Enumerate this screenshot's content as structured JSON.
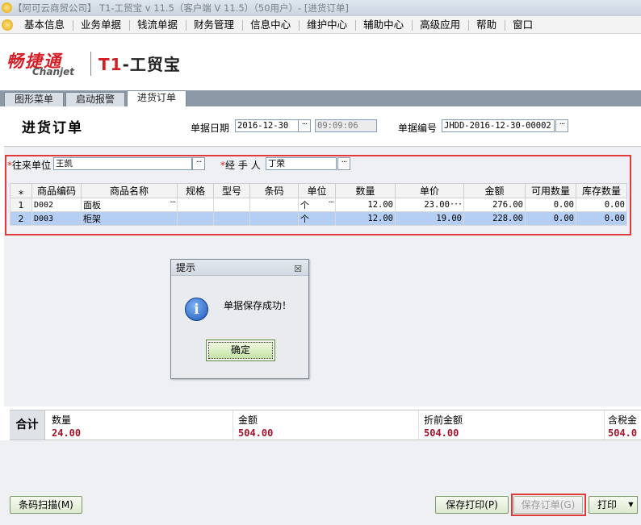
{
  "window": {
    "title": "【阿可云商贸公司】 T1-工贸宝 v 11.5（客户端 V 11.5）（50用户）- [进货订单]"
  },
  "menu": [
    "基本信息",
    "业务单据",
    "钱流单据",
    "财务管理",
    "信息中心",
    "维护中心",
    "辅助中心",
    "高级应用",
    "帮助",
    "窗口"
  ],
  "logo": {
    "brand_cn": "畅捷通",
    "brand_en": "Chanjet",
    "product_prefix": "T1",
    "product_name": "-工贸宝"
  },
  "tabs": [
    {
      "label": "图形菜单"
    },
    {
      "label": "启动报警"
    },
    {
      "label": "进货订单",
      "active": true
    }
  ],
  "form": {
    "title": "进货订单",
    "date_label": "单据日期",
    "date_value": "2016-12-30",
    "time_value": "09:09:06",
    "number_label": "单据编号",
    "number_value": "JHDD-2016-12-30-00002",
    "partner_label": "往来单位",
    "partner_value": "王凯",
    "handler_label": "经 手 人",
    "handler_value": "丁荣",
    "required_mark": "*",
    "dots": "···"
  },
  "table": {
    "corner": "⁎",
    "columns": [
      "商品编码",
      "商品名称",
      "规格",
      "型号",
      "条码",
      "单位",
      "数量",
      "单价",
      "金额",
      "可用数量",
      "库存数量"
    ],
    "rows": [
      {
        "idx": "1",
        "code": "D002",
        "name": "面板",
        "spec": "",
        "model": "",
        "barcode": "",
        "unit": "个",
        "qty": "12.00",
        "price": "23.00",
        "amount": "276.00",
        "avail": "0.00",
        "stock": "0.00"
      },
      {
        "idx": "2",
        "code": "D003",
        "name": "柜架",
        "spec": "",
        "model": "",
        "barcode": "",
        "unit": "个",
        "qty": "12.00",
        "price": "19.00",
        "amount": "228.00",
        "avail": "0.00",
        "stock": "0.00"
      }
    ]
  },
  "summary": {
    "title": "合计",
    "qty_label": "数量",
    "qty_value": "24.00",
    "amount_label": "金额",
    "amount_value": "504.00",
    "pre_discount_label": "折前金额",
    "pre_discount_value": "504.00",
    "tax_label": "含税金",
    "tax_value": "504.0"
  },
  "buttons": {
    "barcode_scan": "条码扫描(M)",
    "save_print": "保存打印(P)",
    "save_order": "保存订单(G)",
    "print": "打印"
  },
  "dialog": {
    "title": "提示",
    "message": "单据保存成功！",
    "ok": "确定",
    "close_glyph": "☒",
    "icon_glyph": "i"
  },
  "colors": {
    "accent_red": "#e03a3a",
    "value_red": "#a3122a",
    "row_selected": "#b5cef3",
    "tab_strip": "#8c9aa8"
  }
}
